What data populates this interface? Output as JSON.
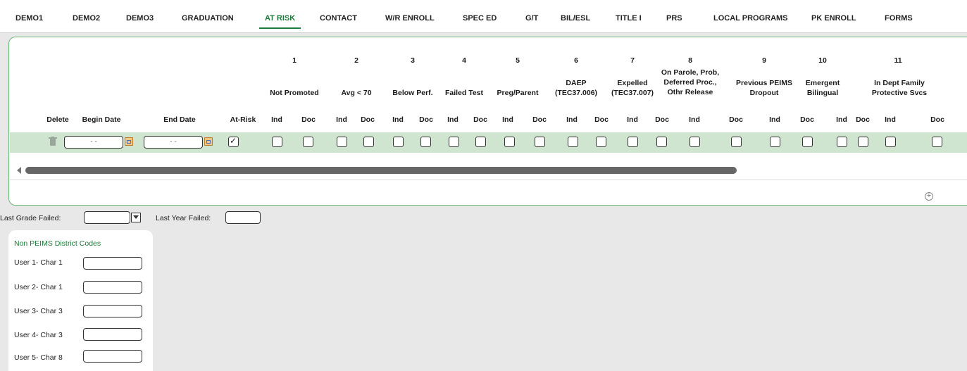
{
  "tabs": [
    "DEMO1",
    "DEMO2",
    "DEMO3",
    "GRADUATION",
    "AT RISK",
    "CONTACT",
    "W/R ENROLL",
    "SPEC ED",
    "G/T",
    "BIL/ESL",
    "TITLE I",
    "PRS",
    "LOCAL PROGRAMS",
    "PK ENROLL",
    "FORMS"
  ],
  "active_tab": "AT RISK",
  "grid": {
    "delete": "Delete",
    "begin_date": "Begin Date",
    "end_date": "End Date",
    "at_risk": "At-Risk",
    "date_placeholder": "- -",
    "ind": "Ind",
    "doc": "Doc",
    "groups": [
      {
        "num": "1",
        "label": "Not Promoted"
      },
      {
        "num": "2",
        "label": "Avg < 70"
      },
      {
        "num": "3",
        "label": "Below Perf."
      },
      {
        "num": "4",
        "label": "Failed Test"
      },
      {
        "num": "5",
        "label": "Preg/Parent"
      },
      {
        "num": "6",
        "label": "DAEP\n(TEC37.006)"
      },
      {
        "num": "7",
        "label": "Expelled\n(TEC37.007)"
      },
      {
        "num": "8",
        "label": "On Parole, Prob,\nDeferred Proc.,\nOthr Release"
      },
      {
        "num": "9",
        "label": "Previous PEIMS\nDropout"
      },
      {
        "num": "10",
        "label": "Emergent\nBilingual"
      },
      {
        "num": "11",
        "label": "In Dept Family\nProtective Svcs"
      }
    ],
    "row": {
      "at_risk_checked": true
    }
  },
  "bottom": {
    "last_grade_failed": "Last Grade Failed:",
    "last_year_failed": "Last Year Failed:",
    "non_peims_title": "Non PEIMS District Codes",
    "user_codes": [
      "User 1- Char 1",
      "User 2- Char 1",
      "User 3- Char 3",
      "User 4- Char 3",
      "User 5- Char 8"
    ]
  },
  "colors": {
    "accent": "#1e7a3a",
    "row_bg": "#cfe5d0",
    "panel_border": "#66b875"
  }
}
